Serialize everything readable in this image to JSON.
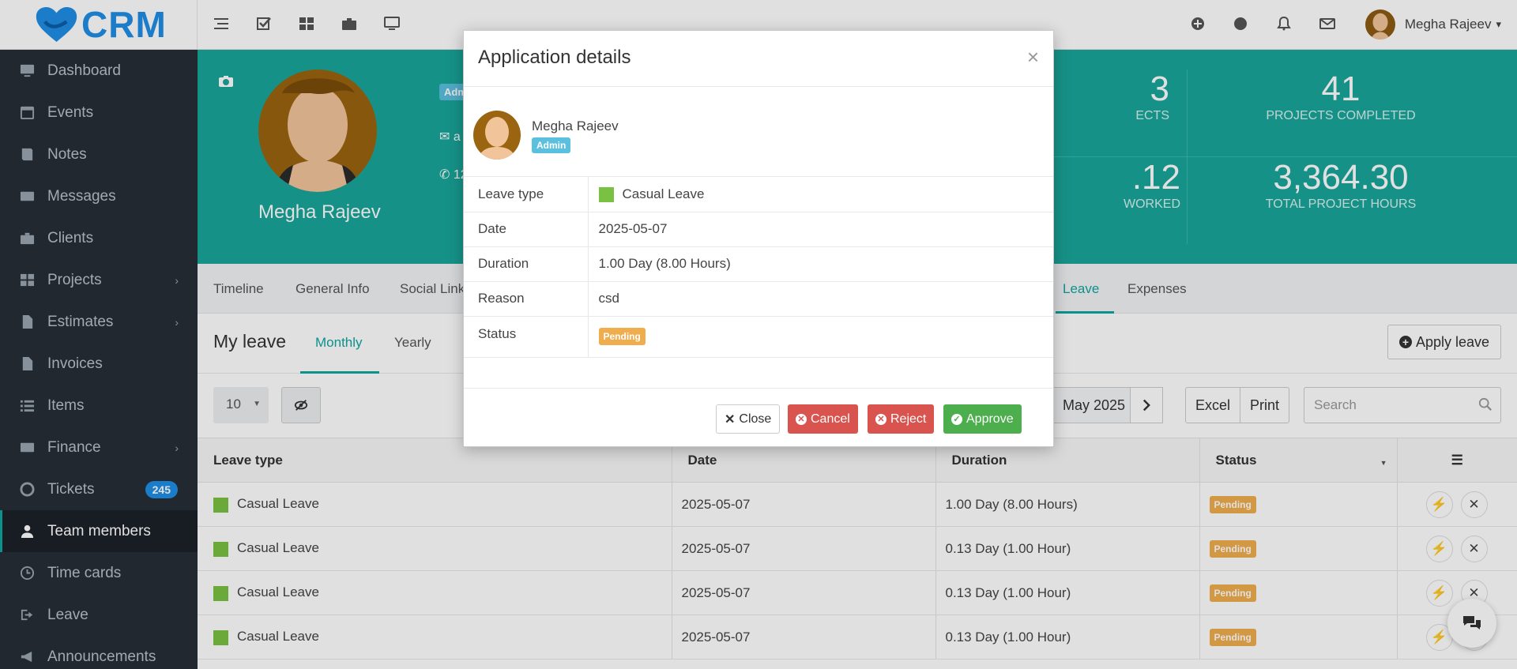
{
  "app": {
    "logo_text": "CRM",
    "brand_color": "#1f8fe6",
    "accent_color": "#1aa59a"
  },
  "sidebar": {
    "items": [
      {
        "label": "Dashboard",
        "icon": "monitor-icon"
      },
      {
        "label": "Events",
        "icon": "calendar-icon"
      },
      {
        "label": "Notes",
        "icon": "book-icon"
      },
      {
        "label": "Messages",
        "icon": "envelope-icon"
      },
      {
        "label": "Clients",
        "icon": "briefcase-icon"
      },
      {
        "label": "Projects",
        "icon": "grid-icon",
        "arrow": "›"
      },
      {
        "label": "Estimates",
        "icon": "file-icon",
        "arrow": "›"
      },
      {
        "label": "Invoices",
        "icon": "file-text-icon"
      },
      {
        "label": "Items",
        "icon": "list-icon"
      },
      {
        "label": "Finance",
        "icon": "money-icon",
        "arrow": "›"
      },
      {
        "label": "Tickets",
        "icon": "life-ring-icon",
        "badge": "245"
      },
      {
        "label": "Team members",
        "icon": "user-icon",
        "active": true
      },
      {
        "label": "Time cards",
        "icon": "clock-icon"
      },
      {
        "label": "Leave",
        "icon": "sign-out-icon"
      },
      {
        "label": "Announcements",
        "icon": "bullhorn-icon"
      }
    ]
  },
  "topbar": {
    "user_name": "Megha Rajeev",
    "caret": "▾"
  },
  "profile": {
    "name": "Megha Rajeev",
    "role_tag": "Adm",
    "email_partial": "a",
    "phone_partial": "12",
    "stats": [
      {
        "num": "3",
        "label": "ECTS"
      },
      {
        "num": "41",
        "label": "PROJECTS COMPLETED"
      },
      {
        "num": ".12",
        "label": "WORKED"
      },
      {
        "num": "3,364.30",
        "label": "TOTAL PROJECT HOURS"
      }
    ]
  },
  "tabs": {
    "items": [
      "Timeline",
      "General Info",
      "Social Link",
      "Leave",
      "Expenses"
    ]
  },
  "leave_panel": {
    "title": "My leave",
    "subtabs": [
      "Monthly",
      "Yearly"
    ],
    "apply_label": "Apply leave",
    "page_length": "10",
    "month": "May 2025",
    "export_buttons": [
      "Excel",
      "Print"
    ],
    "search_placeholder": "Search",
    "columns": [
      "Leave type",
      "Date",
      "Duration",
      "Status"
    ],
    "rows": [
      {
        "type": "Casual Leave",
        "date": "2025-05-07",
        "duration": "1.00 Day (8.00 Hours)",
        "status": "Pending"
      },
      {
        "type": "Casual Leave",
        "date": "2025-05-07",
        "duration": "0.13 Day (1.00 Hour)",
        "status": "Pending"
      },
      {
        "type": "Casual Leave",
        "date": "2025-05-07",
        "duration": "0.13 Day (1.00 Hour)",
        "status": "Pending"
      },
      {
        "type": "Casual Leave",
        "date": "2025-05-07",
        "duration": "0.13 Day (1.00 Hour)",
        "status": "Pending"
      }
    ]
  },
  "modal": {
    "title": "Application details",
    "close_symbol": "×",
    "applicant": {
      "name": "Megha Rajeev",
      "role": "Admin"
    },
    "fields": [
      {
        "key": "Leave type",
        "value": "Casual Leave"
      },
      {
        "key": "Date",
        "value": "2025-05-07"
      },
      {
        "key": "Duration",
        "value": "1.00 Day (8.00 Hours)"
      },
      {
        "key": "Reason",
        "value": "csd"
      },
      {
        "key": "Status",
        "value": "Pending"
      }
    ],
    "buttons": {
      "close": "Close",
      "cancel": "Cancel",
      "reject": "Reject",
      "approve": "Approve"
    }
  }
}
